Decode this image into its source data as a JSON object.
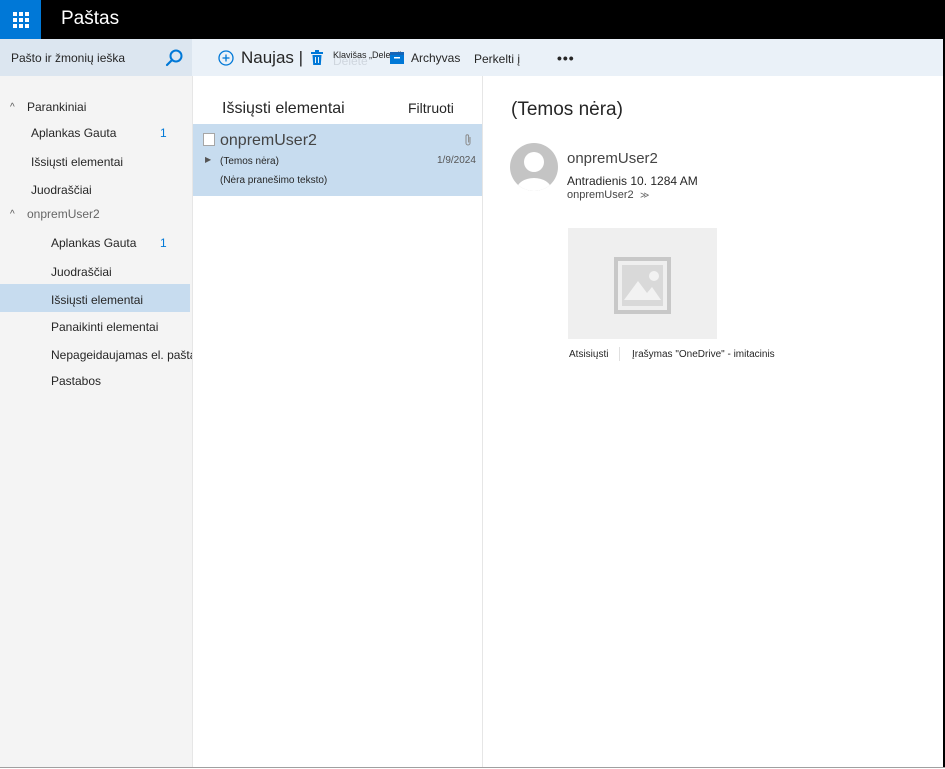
{
  "app": {
    "title": "Paštas",
    "waffle_icon": "app-launcher-icon",
    "accent_color": "#0078d7"
  },
  "search": {
    "placeholder": "Pašto ir žmonių ieška",
    "icon": "search-icon"
  },
  "toolbar": {
    "new_label": "Naujas |",
    "delete_tooltip": "Klavišas „Delete\"",
    "archive_label": "Archyvas",
    "move_label": "Perkelti į",
    "more_label": "•••"
  },
  "nav": {
    "favorites": {
      "label": "Parankiniai",
      "items": [
        {
          "label": "Aplankas Gauta",
          "count": "1"
        },
        {
          "label": "Išsiųsti elementai",
          "count": ""
        },
        {
          "label": "Juodraščiai",
          "count": ""
        }
      ]
    },
    "account": {
      "label": "onpremUser2",
      "items": [
        {
          "label": "Aplankas Gauta",
          "count": "1"
        },
        {
          "label": "Juodraščiai",
          "count": ""
        },
        {
          "label": "Išsiųsti elementai",
          "count": "",
          "selected": true
        },
        {
          "label": "Panaikinti elementai",
          "count": ""
        },
        {
          "label": "Nepageidaujamas el. paštas",
          "count": ""
        },
        {
          "label": "Pastabos",
          "count": ""
        }
      ]
    }
  },
  "list": {
    "title": "Išsiųsti elementai",
    "filter_label": "Filtruoti",
    "messages": [
      {
        "sender": "onpremUser2",
        "subject": "(Temos nėra)",
        "date": "1/9/2024",
        "preview": "(Nėra pranešimo teksto)",
        "has_attachment": true
      }
    ]
  },
  "reading": {
    "subject": "(Temos nėra)",
    "sender": "onpremUser2",
    "date": "Antradienis 10. 1284 AM",
    "to": "onpremUser2",
    "attachment": {
      "download_label": "Atsisiųsti",
      "save_label": "Įrašymas \"OneDrive\" - imitacinis"
    }
  }
}
